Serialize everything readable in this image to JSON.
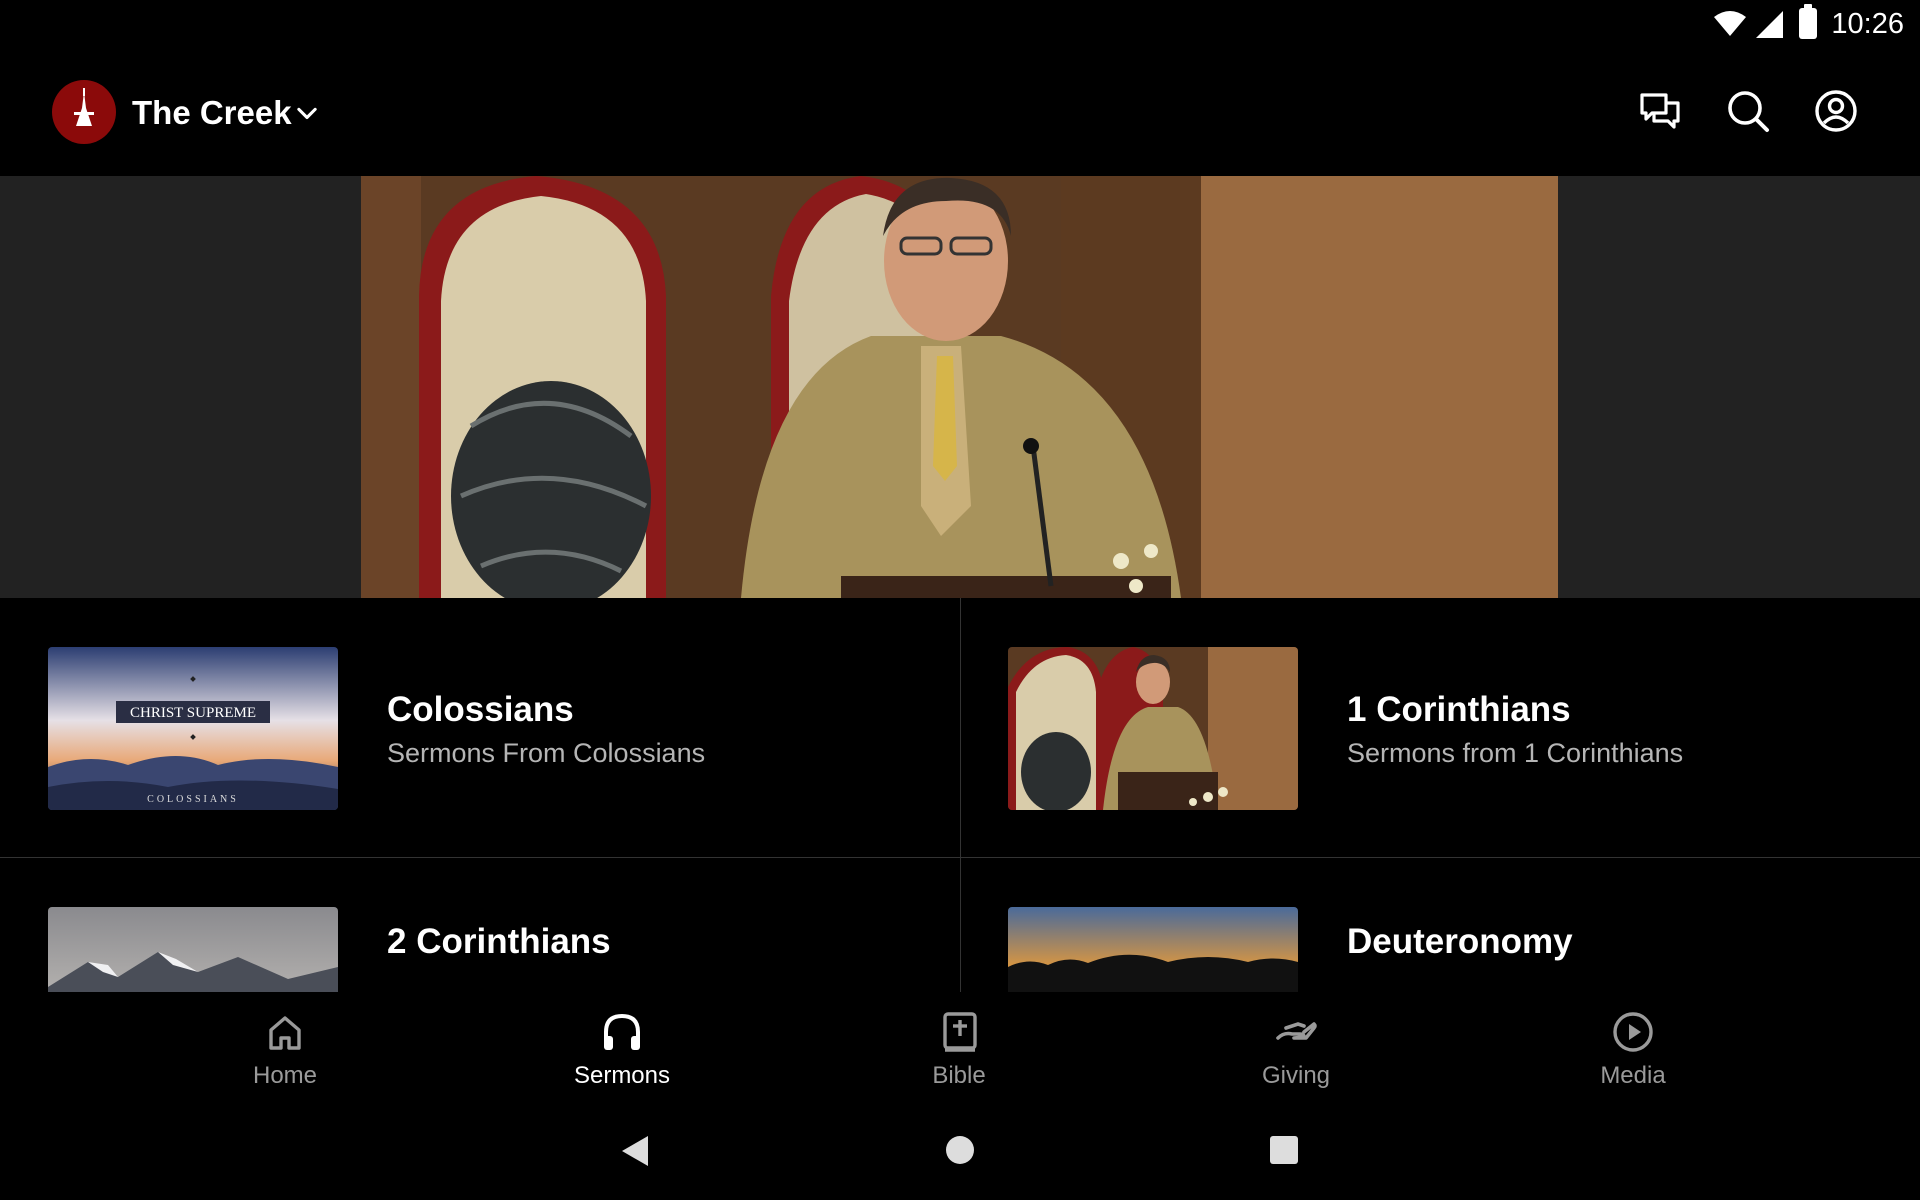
{
  "status_bar": {
    "time": "10:26"
  },
  "app_bar": {
    "church_name": "The Creek",
    "icons": [
      "chevron-down-icon",
      "chat-icon",
      "search-icon",
      "account-icon"
    ]
  },
  "hero": {
    "image": "preacher-at-pulpit"
  },
  "series": [
    {
      "title": "Colossians",
      "subtitle": "Sermons From Colossians",
      "thumbnail_text": "CHRIST SUPREME",
      "thumbnail_caption": "COLOSSIANS"
    },
    {
      "title": "1 Corinthians",
      "subtitle": "Sermons from 1 Corinthians"
    },
    {
      "title": "2 Corinthians",
      "subtitle": ""
    },
    {
      "title": "Deuteronomy",
      "subtitle": ""
    }
  ],
  "bottom_nav": {
    "active": "Sermons",
    "items": [
      {
        "label": "Home",
        "icon": "home-icon"
      },
      {
        "label": "Sermons",
        "icon": "headphones-icon"
      },
      {
        "label": "Bible",
        "icon": "bible-icon"
      },
      {
        "label": "Giving",
        "icon": "giving-icon"
      },
      {
        "label": "Media",
        "icon": "play-circle-icon"
      }
    ]
  },
  "colors": {
    "accent": "#8b0a0a",
    "background": "#000000",
    "inactive": "#9a9a9a",
    "subtitle": "#b5b5b5"
  }
}
